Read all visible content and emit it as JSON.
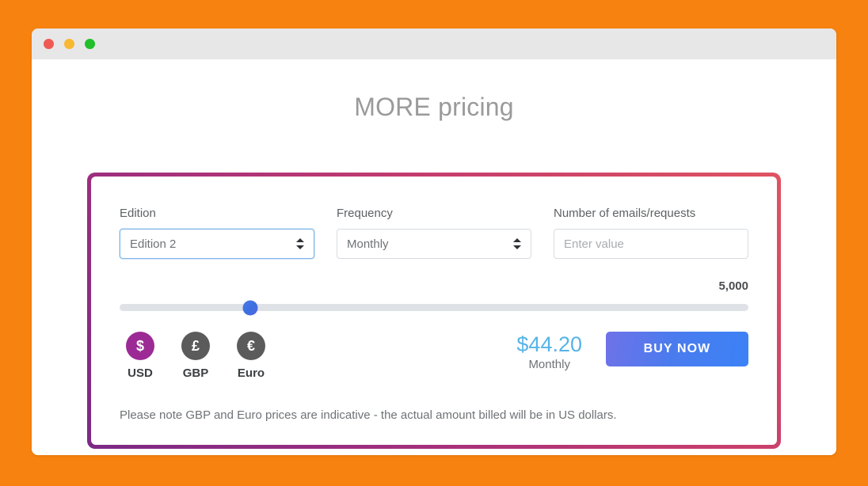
{
  "window": {
    "traffic_lights": [
      {
        "name": "close",
        "color": "#F05A54"
      },
      {
        "name": "minimize",
        "color": "#F8B832"
      },
      {
        "name": "maximize",
        "color": "#22BF2A"
      }
    ]
  },
  "page": {
    "title": "MORE pricing",
    "background_color": "#F7820F"
  },
  "panel": {
    "border_gradient_from": "#7B2A86",
    "border_gradient_to": "#E05361"
  },
  "form": {
    "edition": {
      "label": "Edition",
      "value": "Edition 2",
      "focused": true,
      "options": [
        "Edition 2"
      ]
    },
    "frequency": {
      "label": "Frequency",
      "value": "Monthly",
      "focused": false,
      "options": [
        "Monthly"
      ]
    },
    "quantity": {
      "label": "Number of emails/requests",
      "value": "",
      "placeholder": "Enter value"
    }
  },
  "slider": {
    "value_label": "5,000",
    "value": 5000,
    "percent": 20.8
  },
  "currencies": [
    {
      "code": "USD",
      "symbol": "$",
      "selected": true,
      "color": "#9C2A94"
    },
    {
      "code": "GBP",
      "symbol": "£",
      "selected": false,
      "color": "#5B5B5B"
    },
    {
      "code": "Euro",
      "symbol": "€",
      "selected": false,
      "color": "#5B5B5B"
    }
  ],
  "price": {
    "amount": "$44.20",
    "period": "Monthly",
    "color": "#56B4E8"
  },
  "buy": {
    "label": "BUY NOW"
  },
  "note": {
    "text": "Please note GBP and Euro prices are indicative - the actual amount billed will be in US dollars."
  }
}
